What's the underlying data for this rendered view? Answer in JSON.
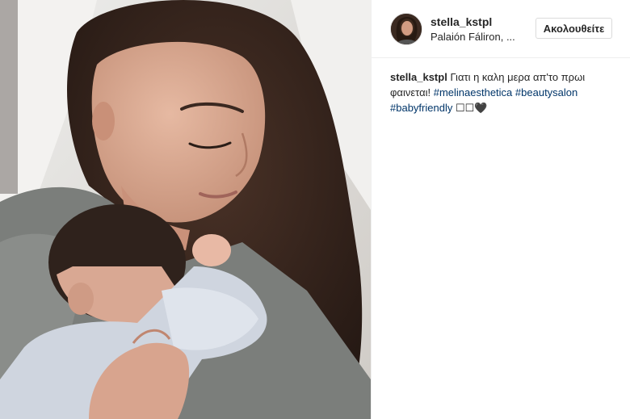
{
  "post": {
    "username": "stella_kstpl",
    "location": "Palaión Fáliron, ...",
    "follow_label": "Ακολουθείτε"
  },
  "caption": {
    "username": "stella_kstpl",
    "line1_text": "Γιατι η καλη μερα απ'το πρωι",
    "line2_text": "φαινεται!",
    "hashtags": [
      "#melinaesthetica",
      "#beautysalon",
      "#babyfriendly"
    ],
    "emojis": "☐☐🖤"
  },
  "photo": {
    "description_icon": "photo-image"
  },
  "colors": {
    "link": "#003569",
    "text": "#262626",
    "border": "#dbdbdb"
  }
}
